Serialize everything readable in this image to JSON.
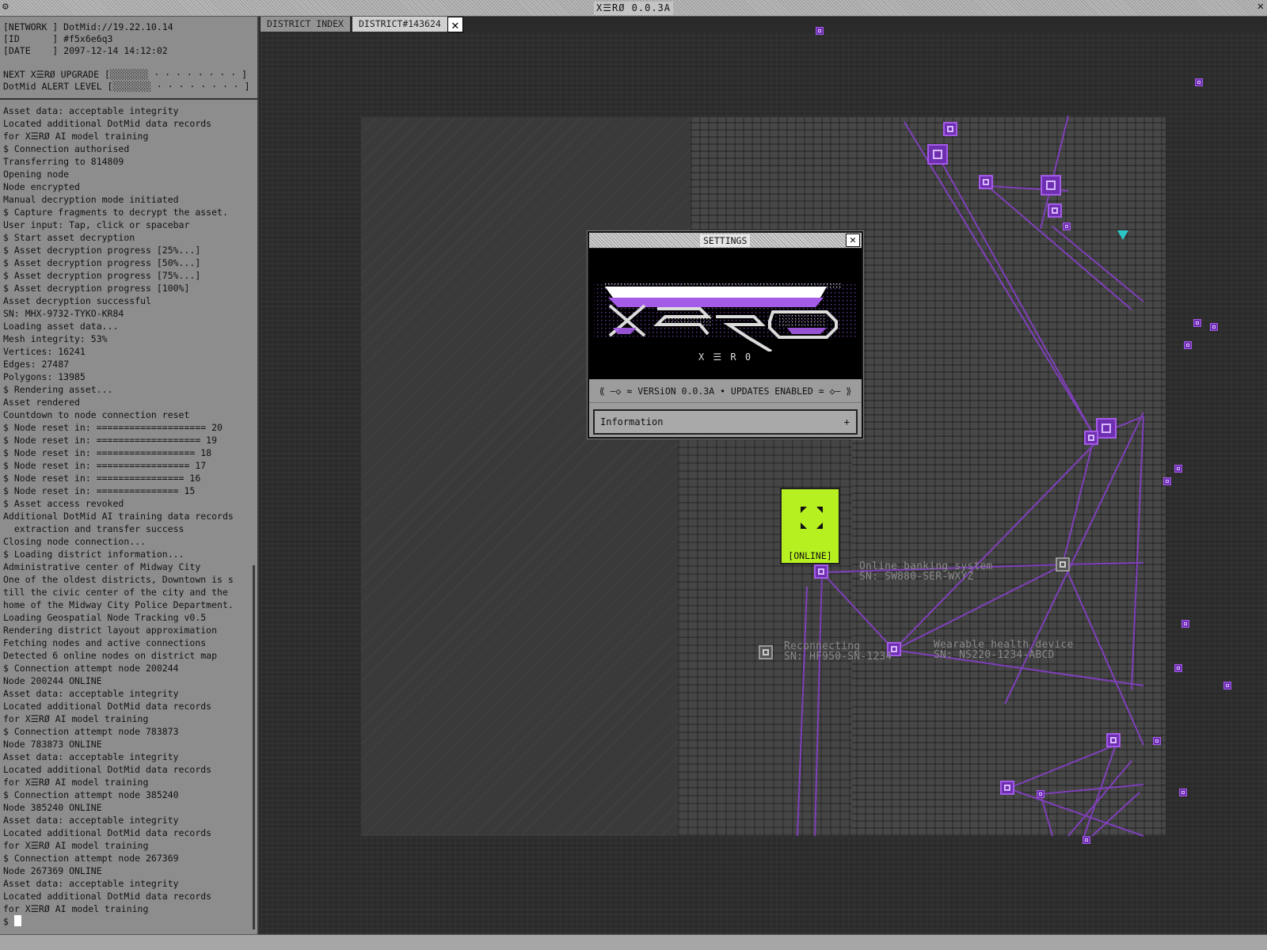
{
  "window": {
    "title": "X☰RØ 0.0.3A",
    "settings_icon": "gear-icon",
    "close_glyph": "✕"
  },
  "sysinfo": {
    "network": "[NETWORK ] DotMid://19.22.10.14",
    "id": "[ID      ] #f5x6e6q3",
    "date": "[DATE    ] 2097-12-14 14:12:02",
    "upgrade_label": "NEXT X☰RØ UPGRADE [",
    "upgrade_meter": "░░░░░░░ · · · · · · · · ]",
    "alert_label": "DotMid ALERT LEVEL [",
    "alert_meter": "░░░░░░░ · · · · · · · · ]"
  },
  "log_text": "Asset data: acceptable integrity\nLocated additional DotMid data records\nfor X☰RØ AI model training\n$ Connection authorised\nTransferring to 814809\nOpening node\nNode encrypted\nManual decryption mode initiated\n$ Capture fragments to decrypt the asset.\nUser input: Tap, click or spacebar\n$ Start asset decryption\n$ Asset decryption progress [25%...]\n$ Asset decryption progress [50%...]\n$ Asset decryption progress [75%...]\n$ Asset decryption progress [100%]\nAsset decryption successful\nSN: MHX-9732-TYKO-KR84\nLoading asset data...\nMesh integrity: 53%\nVertices: 16241\nEdges: 27487\nPolygons: 13985\n$ Rendering asset...\nAsset rendered\nCountdown to node connection reset\n$ Node reset in: ==================== 20\n$ Node reset in: =================== 19\n$ Node reset in: ================== 18\n$ Node reset in: ================= 17\n$ Node reset in: ================ 16\n$ Node reset in: =============== 15\n$ Asset access revoked\nAdditional DotMid AI training data records\n  extraction and transfer success\nClosing node connection...\n$ Loading district information...\nAdministrative center of Midway City\nOne of the oldest districts, Downtown is s\ntill the civic center of the city and the\nhome of the Midway City Police Department.\nLoading Geospatial Node Tracking v0.5\nRendering district layout approximation\nFetching nodes and active connections\nDetected 6 online nodes on district map\n$ Connection attempt node 200244\nNode 200244 ONLINE\nAsset data: acceptable integrity\nLocated additional DotMid data records\nfor X☰RØ AI model training\n$ Connection attempt node 783873\nNode 783873 ONLINE\nAsset data: acceptable integrity\nLocated additional DotMid data records\nfor X☰RØ AI model training\n$ Connection attempt node 385240\nNode 385240 ONLINE\nAsset data: acceptable integrity\nLocated additional DotMid data records\nfor X☰RØ AI model training\n$ Connection attempt node 267369\nNode 267369 ONLINE\nAsset data: acceptable integrity\nLocated additional DotMid data records\nfor X☰RØ AI model training",
  "prompt": "$ ",
  "tabs": [
    {
      "label": "DISTRICT INDEX",
      "active": false
    },
    {
      "label": "DISTRICT#143624",
      "active": true
    }
  ],
  "tab_close_glyph": "✕",
  "map": {
    "node_labels": [
      {
        "name": "Online banking system",
        "sn": "SN: SW880-SER-WXYZ"
      },
      {
        "name": "Reconnecting",
        "sn": "SN: HF950-SN-1234"
      },
      {
        "name": "Wearable health device",
        "sn": "SN: NS220-1234-ABCD"
      }
    ],
    "online_status": "[ONLINE]",
    "accent_color": "#a45be8",
    "online_color": "#b7f021"
  },
  "settings_dialog": {
    "title": "SETTINGS",
    "close_glyph": "✕",
    "logo_tagline": "X  ☰  R  0",
    "version_line": "⟪ –◇ ≈ VERSiON 0.0.3A • UPDATES ENABLED = ◇– ⟫",
    "info_label": "Information",
    "info_plus": "+"
  }
}
